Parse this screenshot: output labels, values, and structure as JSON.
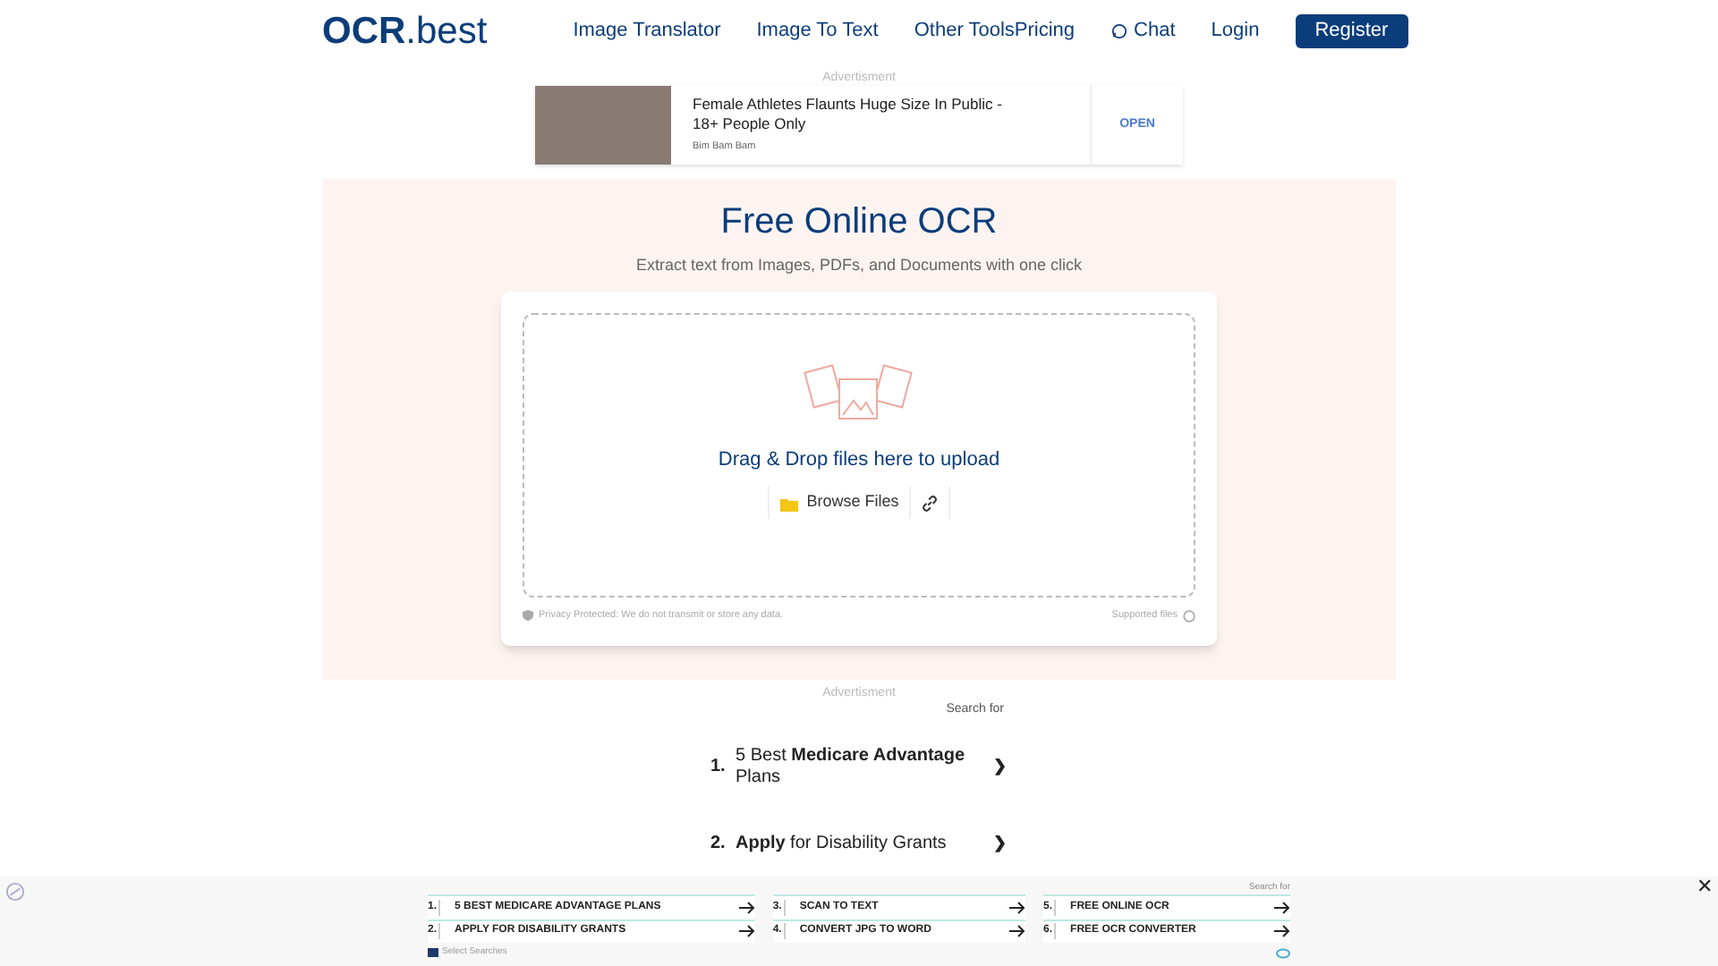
{
  "header": {
    "logo_main": "OCR",
    "logo_suffix": ".best",
    "nav": [
      "Image Translator",
      "Image To Text",
      "Other Tools"
    ],
    "right_links": [
      {
        "kind": "link",
        "label": "Pricing"
      },
      {
        "kind": "chat",
        "label": "Chat"
      },
      {
        "kind": "link",
        "label": "Login"
      },
      {
        "kind": "button",
        "label": "Register"
      }
    ]
  },
  "top_ad": {
    "label": "Advertisment",
    "headline": "Female Athletes Flaunts Huge Size In Public - 18+ People Only",
    "source": "Bim Bam Bam",
    "action": "OPEN"
  },
  "hero": {
    "title": "Free Online OCR",
    "subtitle": "Extract text from Images, PDFs, and Documents with one click",
    "drop_text": "Drag & Drop files here to upload",
    "browse_label": "Browse Files",
    "privacy_note": "Privacy Protected: We do not transmit or store any data.",
    "supported_label": "Supported files"
  },
  "search_ad": {
    "label": "Advertisment",
    "search_for": "Search for",
    "items": [
      {
        "number": "1.",
        "text": "5 Best **Medicare Advantage** Plans",
        "arrow": "❯"
      },
      {
        "number": "2.",
        "text": "**Apply** for Disability Grants",
        "arrow": "❯"
      }
    ]
  },
  "bottom_ad": {
    "search_for": "Search for",
    "items": [
      {
        "number": "1.",
        "text": "5 BEST MEDICARE ADVANTAGE PLANS"
      },
      {
        "number": "2.",
        "text": "APPLY FOR DISABILITY GRANTS"
      },
      {
        "number": "3.",
        "text": "SCAN TO TEXT"
      },
      {
        "number": "4.",
        "text": "CONVERT JPG TO WORD"
      },
      {
        "number": "5.",
        "text": "FREE ONLINE OCR"
      },
      {
        "number": "6.",
        "text": "FREE OCR CONVERTER"
      }
    ],
    "footer": "Select Searches",
    "close": "✕"
  }
}
